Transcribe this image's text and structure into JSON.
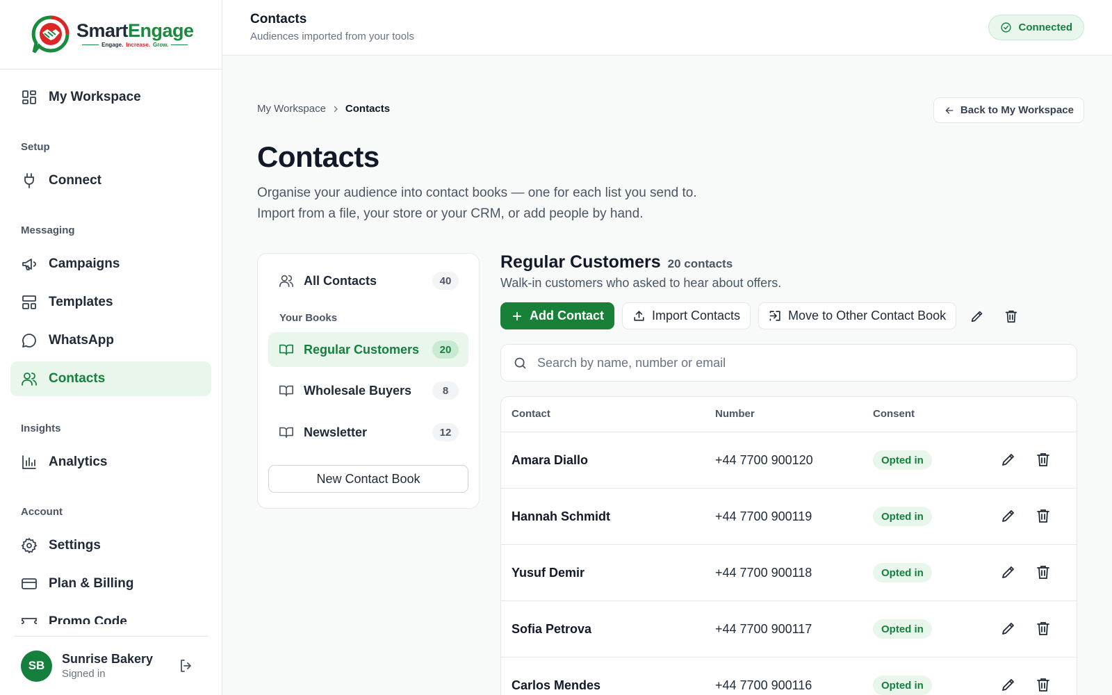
{
  "brand": {
    "name_part1": "Smart",
    "name_part2": "Engage",
    "tag1": "Engage.",
    "tag2": "Increase.",
    "tag3": "Grow.",
    "colors": {
      "green": "#188038",
      "red": "#dc2626",
      "accent_bg": "#e8f6ec"
    }
  },
  "sidebar": {
    "workspace": {
      "label": "My Workspace",
      "icon": "grid-icon"
    },
    "sections": {
      "setup": "Setup",
      "messaging": "Messaging",
      "insights": "Insights",
      "account": "Account"
    },
    "items": {
      "connect": "Connect",
      "campaigns": "Campaigns",
      "templates": "Templates",
      "whatsapp": "WhatsApp",
      "contacts": "Contacts",
      "analytics": "Analytics",
      "settings": "Settings",
      "billing": "Plan & Billing",
      "promo": "Promo Code"
    },
    "active": "contacts",
    "user": {
      "initials": "SB",
      "name": "Sunrise Bakery",
      "status": "Signed in"
    }
  },
  "topbar": {
    "title": "Contacts",
    "subtitle": "Audiences imported from your tools",
    "status": "Connected"
  },
  "breadcrumb": {
    "parent": "My Workspace",
    "current": "Contacts"
  },
  "back_button": "Back to My Workspace",
  "page": {
    "title": "Contacts",
    "desc_line1": "Organise your audience into contact books — one for each list you send to.",
    "desc_line2": "Import from a file, your store or your CRM, or add people by hand."
  },
  "books": {
    "all": {
      "label": "All Contacts",
      "count": "40"
    },
    "section_label": "Your Books",
    "list": [
      {
        "label": "Regular Customers",
        "count": "20",
        "active": true
      },
      {
        "label": "Wholesale Buyers",
        "count": "8",
        "active": false
      },
      {
        "label": "Newsletter",
        "count": "12",
        "active": false
      }
    ],
    "new_button": "New Contact Book"
  },
  "detail": {
    "title": "Regular Customers",
    "count_text": "20 contacts",
    "description": "Walk-in customers who asked to hear about offers.",
    "actions": {
      "add": "Add Contact",
      "import": "Import Contacts",
      "move": "Move to Other Contact Book"
    },
    "search_placeholder": "Search by name, number or email",
    "columns": {
      "contact": "Contact",
      "number": "Number",
      "consent": "Consent"
    },
    "rows": [
      {
        "name": "Amara Diallo",
        "number": "+44 7700 900120",
        "consent": "Opted in"
      },
      {
        "name": "Hannah Schmidt",
        "number": "+44 7700 900119",
        "consent": "Opted in"
      },
      {
        "name": "Yusuf Demir",
        "number": "+44 7700 900118",
        "consent": "Opted in"
      },
      {
        "name": "Sofia Petrova",
        "number": "+44 7700 900117",
        "consent": "Opted in"
      },
      {
        "name": "Carlos Mendes",
        "number": "+44 7700 900116",
        "consent": "Opted in"
      }
    ]
  }
}
